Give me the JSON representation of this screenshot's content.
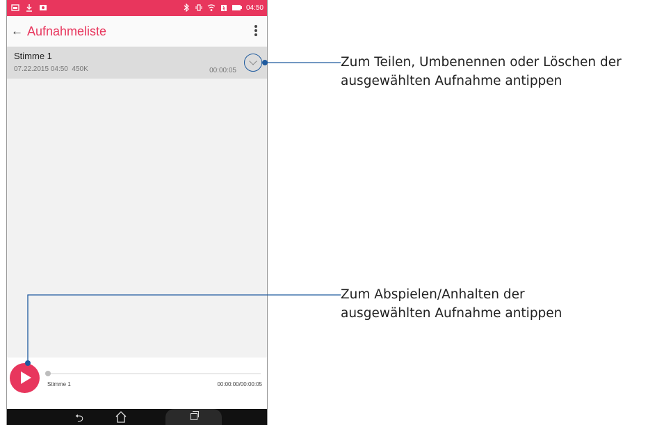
{
  "app": {
    "title": "Aufnahmeliste",
    "status_time": "04:50"
  },
  "recordings": [
    {
      "title": "Stimme 1",
      "date": "07.22.2015 04:50",
      "size": "450K",
      "duration": "00:00:05"
    }
  ],
  "player": {
    "name": "Stimme 1",
    "time": "00:00:00/00:00:05"
  },
  "callouts": {
    "share": {
      "line1": "Zum Teilen, Umbenennen oder Löschen der",
      "line2": "ausgewählten Aufnahme antippen"
    },
    "play": {
      "line1": "Zum Abspielen/Anhalten der",
      "line2": "ausgewählten Aufnahme antippen"
    }
  },
  "icons": {
    "back": "arrow-left",
    "menu": "three-dot-vertical",
    "expand": "chevron-down",
    "play": "play",
    "nav_back": "back",
    "nav_home": "home",
    "nav_recent": "recent-apps"
  },
  "colors": {
    "accent": "#e8365d",
    "callout_line": "#1e5a9e"
  }
}
